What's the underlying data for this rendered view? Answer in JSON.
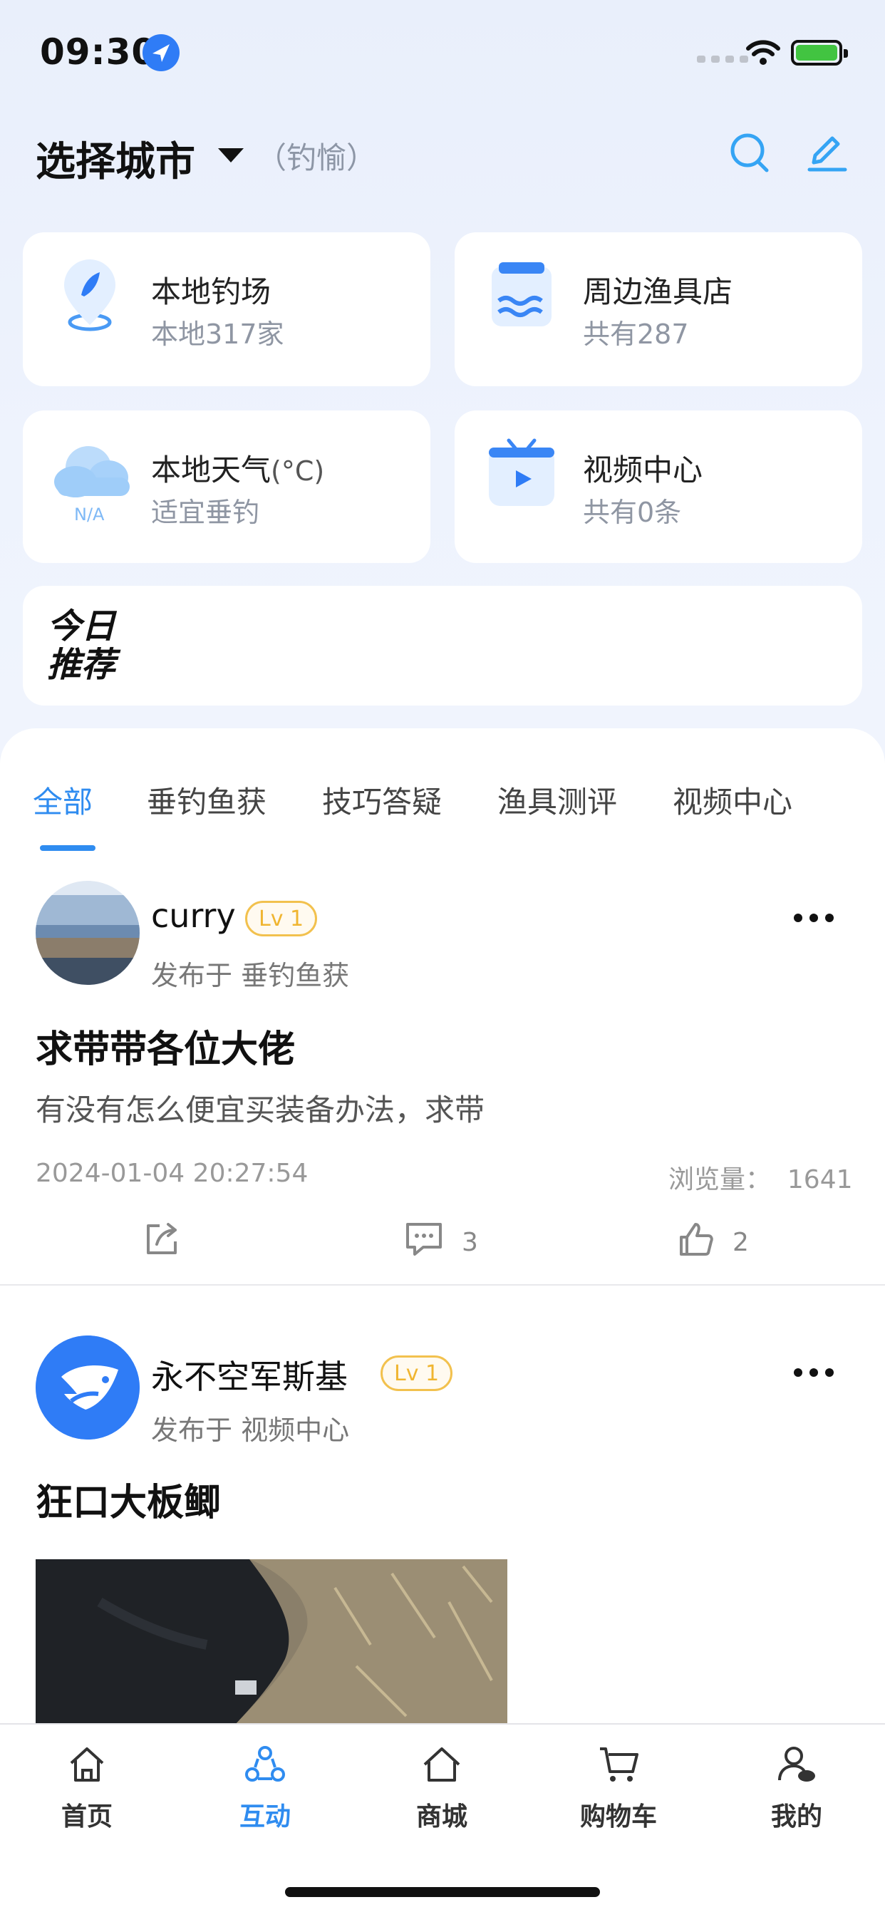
{
  "status_bar": {
    "time": "09:30"
  },
  "header": {
    "city_label": "选择城市",
    "app_name": "（钓愉）"
  },
  "cards": [
    {
      "title": "本地钓场",
      "subtitle": "本地317家"
    },
    {
      "title": "周边渔具店",
      "subtitle": "共有287"
    },
    {
      "title": "本地天气",
      "unit": "(°C)",
      "subtitle": "适宜垂钓",
      "weather_value": "N/A"
    },
    {
      "title": "视频中心",
      "subtitle": "共有0条"
    }
  ],
  "recommend": {
    "line1": "今日",
    "line2": "推荐"
  },
  "tabs": [
    {
      "label": "全部"
    },
    {
      "label": "垂钓鱼获"
    },
    {
      "label": "技巧答疑"
    },
    {
      "label": "渔具测评"
    },
    {
      "label": "视频中心"
    }
  ],
  "posts": [
    {
      "username": "curry",
      "level": "Lv 1",
      "published_in": "发布于  垂钓鱼获",
      "title": "求带带各位大佬",
      "body": "有没有怎么便宜买装备办法，求带",
      "date": "2024-01-04 20:27:54",
      "views_label": "浏览量：",
      "views": "1641",
      "comments": "3",
      "likes": "2"
    },
    {
      "username": "永不空军斯基",
      "level": "Lv 1",
      "published_in": "发布于  视频中心",
      "title": "狂口大板鲫"
    }
  ],
  "nav": [
    {
      "label": "首页"
    },
    {
      "label": "互动"
    },
    {
      "label": "商城"
    },
    {
      "label": "购物车"
    },
    {
      "label": "我的"
    }
  ],
  "colors": {
    "accent": "#2f8cf0",
    "level_badge": "#f2c14e",
    "background": "#eef2fb"
  }
}
